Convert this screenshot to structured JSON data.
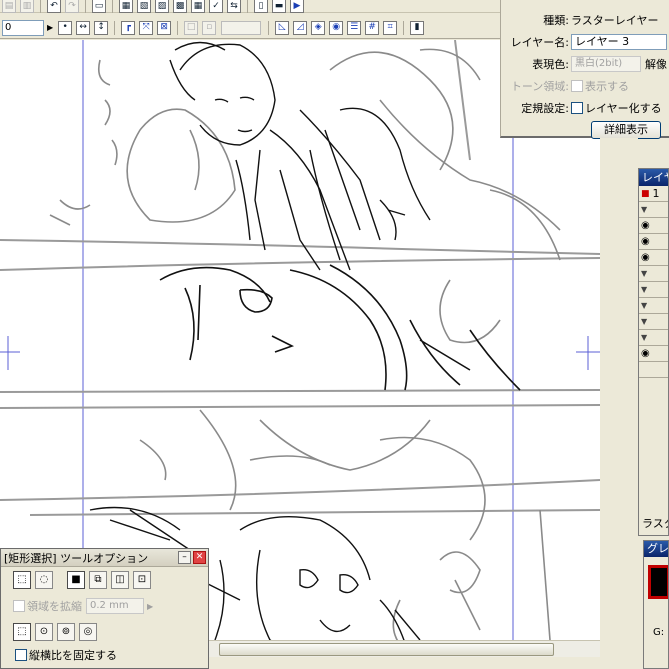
{
  "toolbar": {
    "zoom_value": "0"
  },
  "layer_property": {
    "type_label": "種類:",
    "type_value": "ラスターレイヤー",
    "name_label": "レイヤー名:",
    "name_value": "レイヤー 3",
    "name_extra": "",
    "color_label": "表現色:",
    "color_value": "黒白(2bit)",
    "color_extra": "解像",
    "tone_label": "トーン領域:",
    "tone_value": "表示する",
    "ruler_label": "定規設定:",
    "ruler_value": "レイヤー化する",
    "detail_button": "詳細表示"
  },
  "layer_panel": {
    "title": "レイヤ",
    "count": "1",
    "bottom_label": "ラスタ"
  },
  "grey_panel": {
    "title": "グレ",
    "g_label": "G:"
  },
  "tool_option": {
    "title": "[矩形選択] ツールオプション",
    "expand_label": "領域を拡縮",
    "expand_value": "0.2 mm",
    "aspect_label": "縦横比を固定する"
  },
  "canvas": {
    "sketch_color": "#8a8a8a",
    "ink_color": "#111111",
    "guide_color": "#5b5fd6"
  },
  "icons": {
    "toolbar_row1": [
      "copy-icon",
      "delete-icon",
      "undo-icon",
      "redo-icon",
      "print-icon",
      "layer-icon-1",
      "layer-icon-2",
      "layer-icon-3",
      "layer-icon-4",
      "grid-icon",
      "check-icon",
      "swap-icon",
      "page-icon",
      "note-icon",
      "play-icon"
    ],
    "toolbar_row2": [
      "dot-select-icon",
      "move-horizontal-icon",
      "move-vertical-icon",
      "ruler-icon",
      "transform-icon",
      "crop-icon",
      "disabled-icon",
      "ruler-triangle-icon",
      "ruler-set-icon",
      "perspective-icon",
      "shape-icon",
      "lines-icon",
      "grid-hash-icon",
      "grid-hash2-icon",
      "panel-icon"
    ]
  }
}
